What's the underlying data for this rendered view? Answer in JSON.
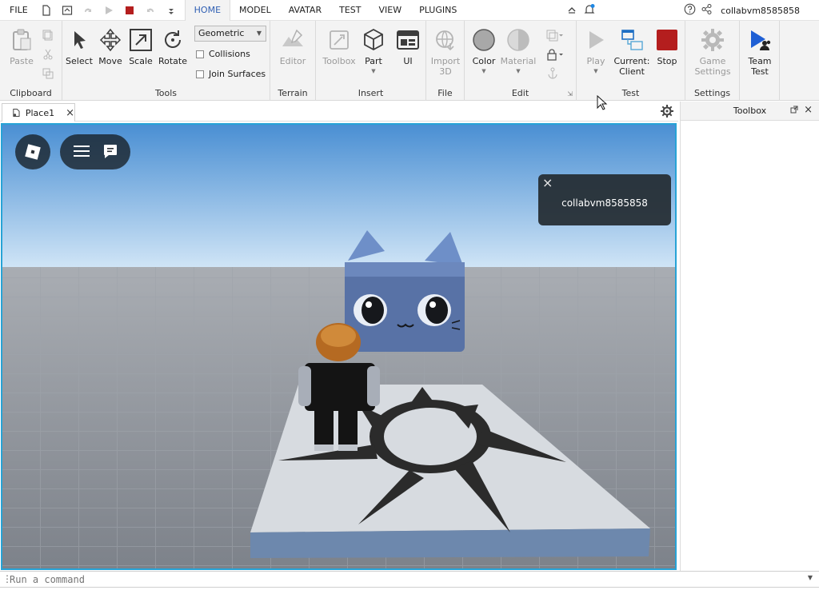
{
  "menu": {
    "file": "FILE",
    "tabs": [
      {
        "label": "HOME",
        "active": true
      },
      {
        "label": "MODEL",
        "active": false
      },
      {
        "label": "AVATAR",
        "active": false
      },
      {
        "label": "TEST",
        "active": false
      },
      {
        "label": "VIEW",
        "active": false
      },
      {
        "label": "PLUGINS",
        "active": false
      }
    ],
    "username": "collabvm8585858"
  },
  "ribbon": {
    "clipboard": {
      "label": "Clipboard",
      "paste": "Paste"
    },
    "tools": {
      "label": "Tools",
      "select": "Select",
      "move": "Move",
      "scale": "Scale",
      "rotate": "Rotate",
      "mode_value": "Geometric",
      "collisions": "Collisions",
      "join_surfaces": "Join Surfaces"
    },
    "terrain": {
      "label": "Terrain",
      "editor": "Editor"
    },
    "insert": {
      "label": "Insert",
      "toolbox": "Toolbox",
      "part": "Part",
      "ui": "UI"
    },
    "file": {
      "label": "File",
      "import3d_line1": "Import",
      "import3d_line2": "3D"
    },
    "edit": {
      "label": "Edit",
      "color": "Color",
      "material": "Material"
    },
    "test": {
      "label": "Test",
      "play": "Play",
      "current_line1": "Current:",
      "current_line2": "Client",
      "stop": "Stop"
    },
    "settings": {
      "label": "Settings",
      "game_line1": "Game",
      "game_line2": "Settings"
    },
    "team": {
      "line1": "Team",
      "line2": "Test"
    }
  },
  "document": {
    "tab_label": "Place1"
  },
  "toolbox_panel": {
    "title": "Toolbox"
  },
  "viewport": {
    "toast_message": "collabvm8585858"
  },
  "command_bar": {
    "placeholder": "Run a command"
  },
  "colors": {
    "accent_blue": "#2f5fb3",
    "viewport_border": "#27a3d6",
    "stop_red": "#b41e1e",
    "sky_top": "#4a8fd3",
    "sky_bottom": "#cfe4f6",
    "baseplate": "#8a8f97"
  }
}
